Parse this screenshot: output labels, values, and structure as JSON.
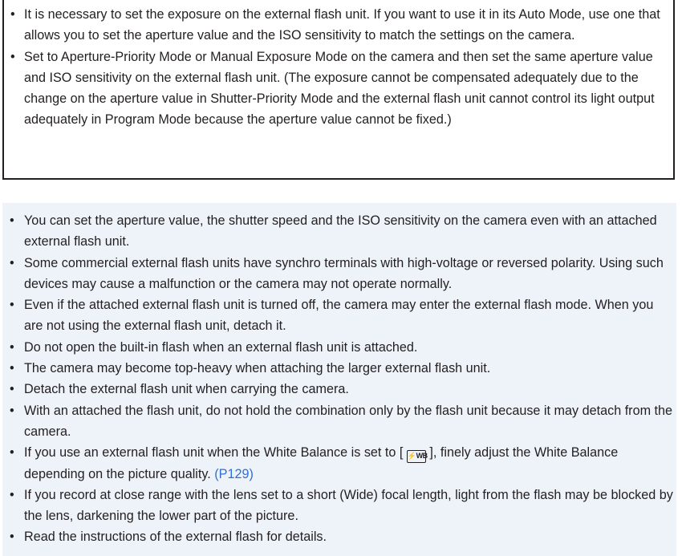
{
  "bullet": "•",
  "box_items": [
    "It is necessary to set the exposure on the external flash unit. If you want to use it in its Auto Mode, use one that allows you to set the aperture value and the ISO sensitivity to match the settings on the camera.",
    "Set to Aperture-Priority Mode or Manual Exposure Mode on the camera and then set the same aperture value and ISO sensitivity on the external flash unit. (The exposure cannot be compensated adequately due to the change on the aperture value in Shutter-Priority Mode and the external flash unit cannot control its light output adequately in Program Mode because the aperture value cannot be fixed.)"
  ],
  "note_items": [
    "You can set the aperture value, the shutter speed and the ISO sensitivity on the camera even with an attached external flash unit.",
    "Some commercial external flash units have synchro terminals with high-voltage or reversed polarity. Using such devices may cause a malfunction or the camera may not operate normally.",
    "Even if the attached external flash unit is turned off, the camera may enter the external flash mode. When you are not using the external flash unit, detach it.",
    "Do not open the built-in flash when an external flash unit is attached.",
    "The camera may become top-heavy when attaching the larger external flash unit.",
    "Detach the external flash unit when carrying the camera.",
    "With an attached the flash unit, do not hold the combination only by the flash unit because it may detach from the camera."
  ],
  "wb_item": {
    "before": "If you use an external flash unit when the White Balance is set to [ ",
    "icon": "⚡WB",
    "after": " ], finely adjust the White Balance depending on the picture quality. ",
    "link": "(P129)"
  },
  "note_items_tail": [
    "If you record at close range with the lens set to a short (Wide) focal length, light from the flash may be blocked by the lens, darkening the lower part of the picture.",
    "Read the instructions of the external flash for details."
  ],
  "colors": {
    "text": "#231f20",
    "note_background": "#eef3fa",
    "link": "#2e6fd9"
  },
  "icons": {
    "wb_icon": "flash-white-balance-icon"
  }
}
